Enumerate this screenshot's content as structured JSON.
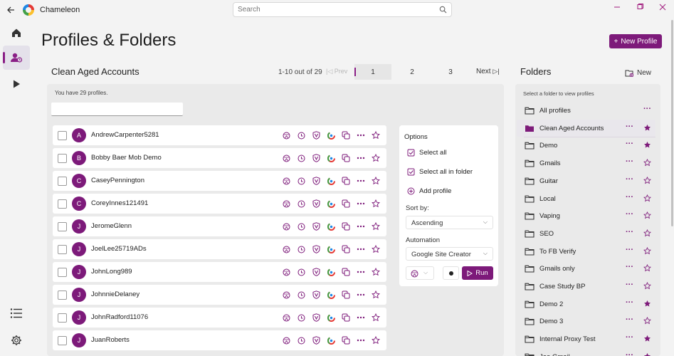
{
  "app": {
    "title": "Chameleon"
  },
  "search": {
    "placeholder": "Search"
  },
  "page": {
    "title": "Profiles & Folders",
    "new_profile_label": "New Profile"
  },
  "profiles": {
    "group_title": "Clean Aged Accounts",
    "range_text": "1-10 out of 29",
    "prev_label": "Prev",
    "next_label": "Next",
    "pages": [
      "1",
      "2",
      "3"
    ],
    "current_page": "1",
    "count_text": "You have 29 profiles.",
    "filter_value": "",
    "rows": [
      {
        "initial": "A",
        "name": "AndrewCarpenter5281"
      },
      {
        "initial": "B",
        "name": "Bobby Baer Mob Demo"
      },
      {
        "initial": "C",
        "name": "CaseyPennington"
      },
      {
        "initial": "C",
        "name": "CoreyInnes121491"
      },
      {
        "initial": "J",
        "name": "JeromeGlenn"
      },
      {
        "initial": "J",
        "name": "JoelLee25719ADs"
      },
      {
        "initial": "J",
        "name": "JohnLong989"
      },
      {
        "initial": "J",
        "name": "JohnnieDelaney"
      },
      {
        "initial": "J",
        "name": "JohnRadford11076"
      },
      {
        "initial": "J",
        "name": "JuanRoberts"
      }
    ],
    "row_action_icons": [
      "browser-engine-icon",
      "timezone-icon",
      "shield-icon",
      "chrome-icon",
      "copy-icon",
      "more-icon",
      "star-icon"
    ]
  },
  "options": {
    "title": "Options",
    "select_all": "Select all",
    "select_all_folder": "Select all in folder",
    "add_profile": "Add profile",
    "sort_label": "Sort by:",
    "sort_value": "Ascending",
    "automation_label": "Automation",
    "automation_value": "Google Site Creator",
    "run_label": "Run"
  },
  "folders": {
    "title": "Folders",
    "new_label": "New",
    "hint": "Select a folder to view profiles",
    "items": [
      {
        "name": "All profiles",
        "starred": null,
        "selected": false
      },
      {
        "name": "Clean Aged Accounts",
        "starred": true,
        "selected": true
      },
      {
        "name": "Demo",
        "starred": true,
        "selected": false
      },
      {
        "name": "Gmails",
        "starred": false,
        "selected": false
      },
      {
        "name": "Guitar",
        "starred": false,
        "selected": false
      },
      {
        "name": "Local",
        "starred": false,
        "selected": false
      },
      {
        "name": "Vaping",
        "starred": false,
        "selected": false
      },
      {
        "name": "SEO",
        "starred": false,
        "selected": false
      },
      {
        "name": "To FB Verify",
        "starred": false,
        "selected": false
      },
      {
        "name": "Gmails only",
        "starred": false,
        "selected": false
      },
      {
        "name": "Case Study BP",
        "starred": false,
        "selected": false
      },
      {
        "name": "Demo 2",
        "starred": true,
        "selected": false
      },
      {
        "name": "Demo 3",
        "starred": false,
        "selected": false
      },
      {
        "name": "Internal Proxy Test",
        "starred": true,
        "selected": false
      },
      {
        "name": "Joe Gmail",
        "starred": true,
        "selected": false
      }
    ]
  },
  "colors": {
    "accent": "#7d1a7a",
    "panel": "#eaeaea",
    "background": "#f3f3f3"
  }
}
